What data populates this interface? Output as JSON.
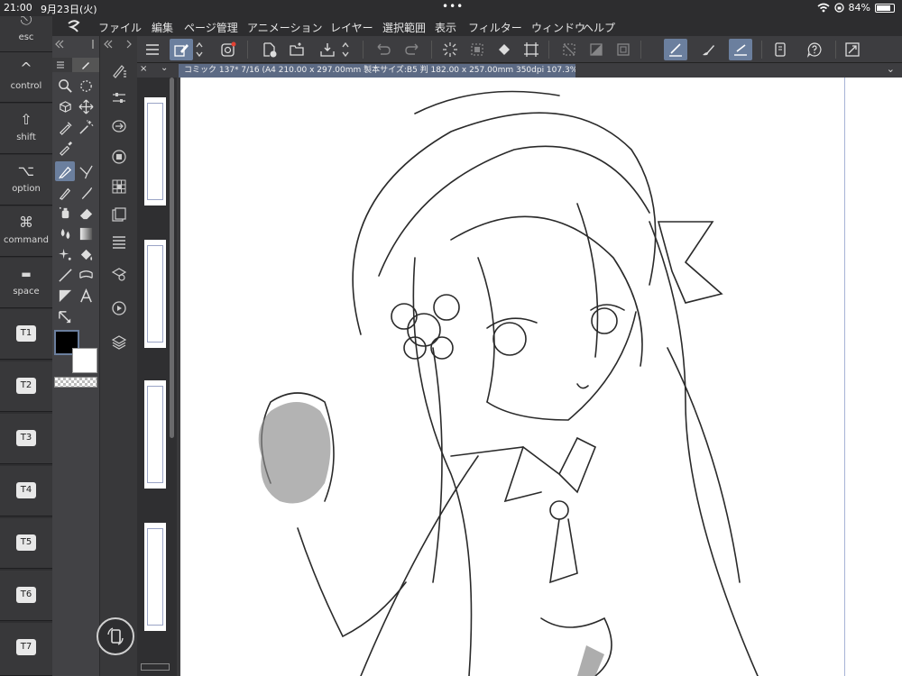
{
  "status": {
    "time": "21:00",
    "date": "9月23日(火)",
    "dots": "•••",
    "battery_text": "84%",
    "battery_level": 0.84
  },
  "menu": {
    "items": [
      "ファイル",
      "編集",
      "ページ管理",
      "アニメーション",
      "レイヤー",
      "選択範囲",
      "表示",
      "フィルター",
      "ウィンドウ",
      "ヘルプ"
    ]
  },
  "modifier_keys": [
    {
      "glyph": "⎋",
      "label": "esc"
    },
    {
      "glyph": "^",
      "label": "control"
    },
    {
      "glyph": "⇧",
      "label": "shift"
    },
    {
      "glyph": "⌥",
      "label": "option"
    },
    {
      "glyph": "⌘",
      "label": "command"
    },
    {
      "glyph": "▬",
      "label": "space"
    }
  ],
  "custom_keys": [
    "T1",
    "T2",
    "T3",
    "T4",
    "T5",
    "T6",
    "T7"
  ],
  "canvas": {
    "tab_title": "コミック 137* 7/16 (A4 210.00 x 297.00mm 製本サイズ:B5 判 182.00 x 257.00mm 350dpi 107.3%)",
    "close_label": "×",
    "expand_label": "⌄"
  },
  "colors": {
    "main": "#000000",
    "sub": "#ffffff",
    "accent": "#6b7f9e"
  }
}
